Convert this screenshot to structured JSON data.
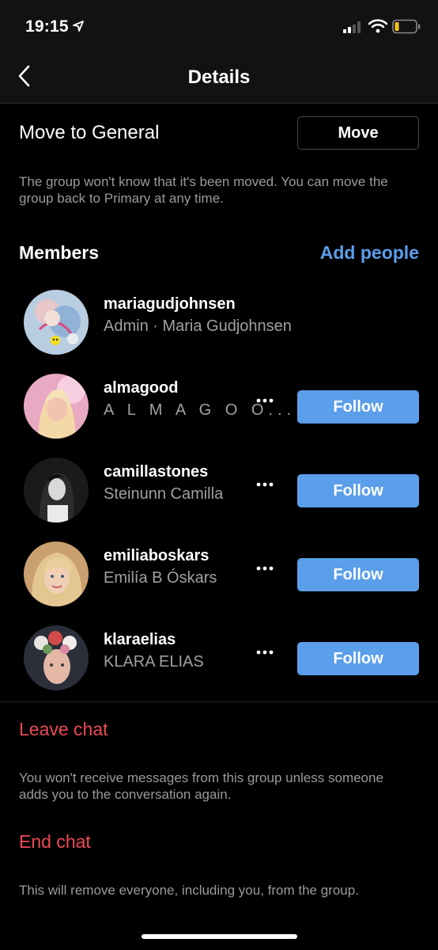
{
  "status_bar": {
    "time": "19:15"
  },
  "nav": {
    "title": "Details"
  },
  "move_section": {
    "label": "Move to General",
    "button": "Move",
    "hint": "The group won't know that it's been moved. You can move the group back to Primary at any time."
  },
  "members_section": {
    "title": "Members",
    "add_people": "Add people",
    "members": [
      {
        "username": "mariagudjohnsen",
        "subtitle": "Admin · Maria Gudjohnsen"
      },
      {
        "username": "almagood",
        "subtitle": "A L M A  G O O...",
        "follow": "Follow"
      },
      {
        "username": "camillastones",
        "subtitle": "Steinunn Camilla",
        "follow": "Follow"
      },
      {
        "username": "emiliaboskars",
        "subtitle": "Emilía B Óskars",
        "follow": "Follow"
      },
      {
        "username": "klaraelias",
        "subtitle": "KLARA ELIAS",
        "follow": "Follow"
      }
    ]
  },
  "leave_chat": {
    "label": "Leave chat",
    "hint": "You won't receive messages from this group unless someone adds you to the conversation again."
  },
  "end_chat": {
    "label": "End chat",
    "hint": "This will remove everyone, including you, from the group."
  },
  "colors": {
    "accent_blue": "#5b9ee9",
    "danger_red": "#ed4956",
    "background": "#000000",
    "header": "#121212",
    "secondary_text": "#9a9a9a"
  }
}
